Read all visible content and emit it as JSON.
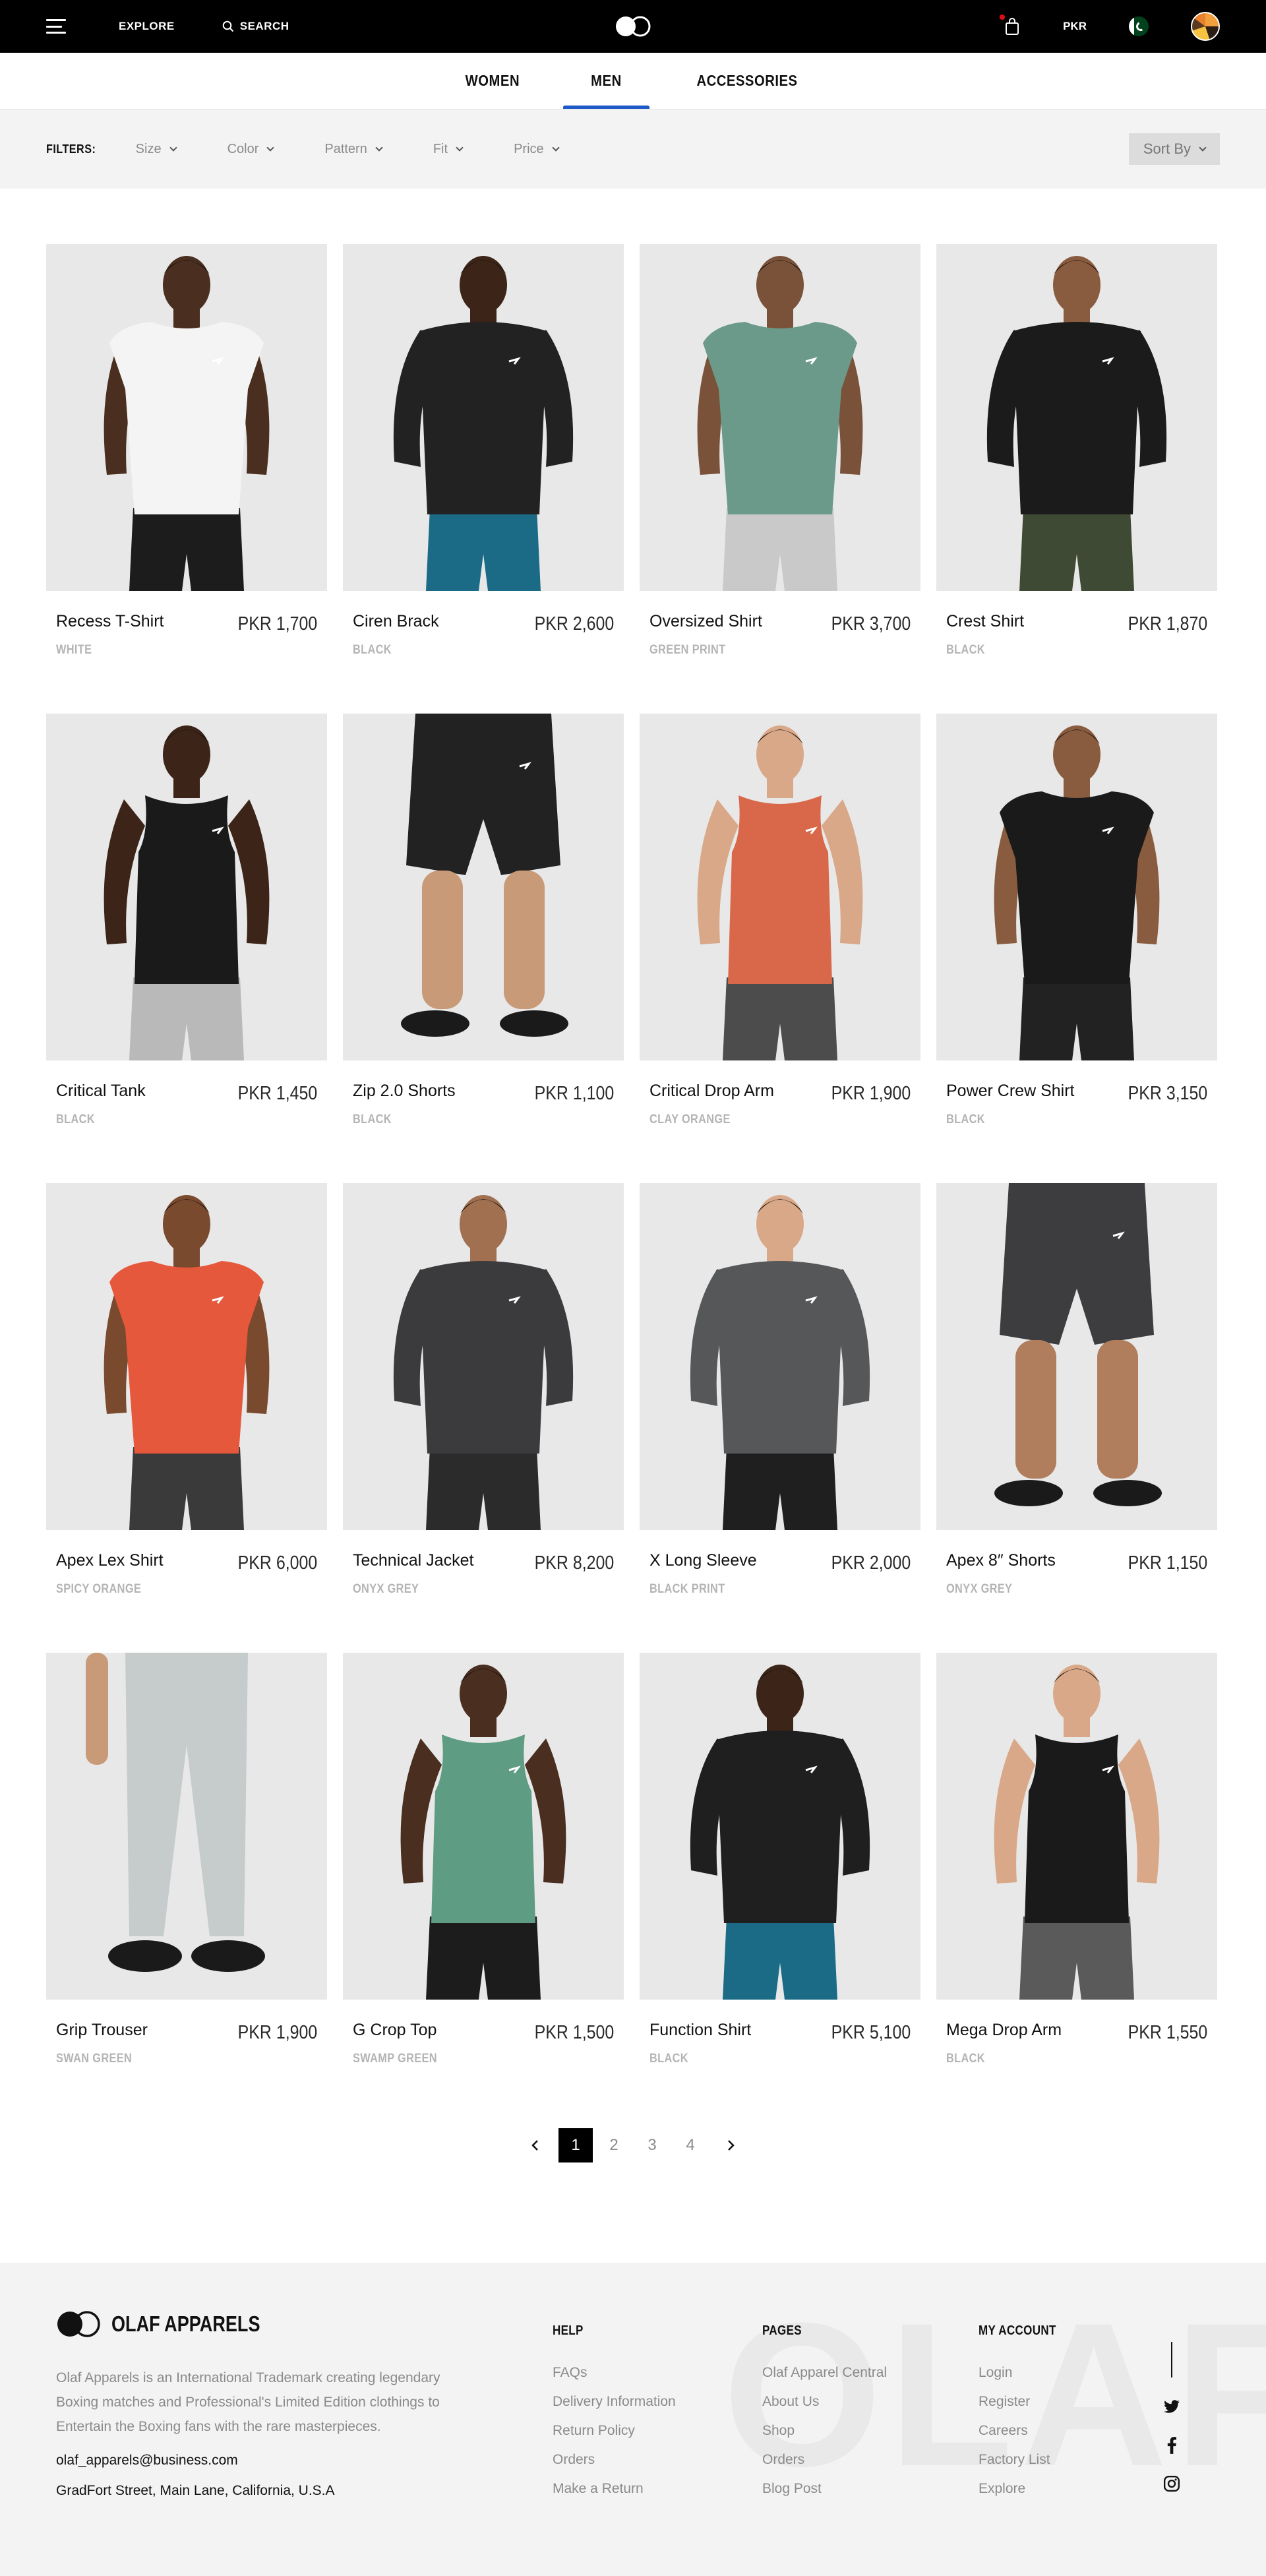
{
  "header": {
    "explore_label": "EXPLORE",
    "search_label": "SEARCH",
    "currency": "PKR"
  },
  "categories": [
    {
      "label": "WOMEN"
    },
    {
      "label": "MEN",
      "active": true
    },
    {
      "label": "ACCESSORIES"
    }
  ],
  "filters": {
    "label": "FILTERS:",
    "items": [
      {
        "label": "Size"
      },
      {
        "label": "Color"
      },
      {
        "label": "Pattern"
      },
      {
        "label": "Fit"
      },
      {
        "label": "Price"
      }
    ],
    "sort_label": "Sort By"
  },
  "products": [
    {
      "name": "Recess T-Shirt",
      "price": "PKR 1,700",
      "color": "WHITE",
      "shirt": "#f4f4f4",
      "bottom": "#1c1c1c",
      "skin": "#4a2e1f",
      "kind": "tee"
    },
    {
      "name": "Ciren Brack",
      "price": "PKR 2,600",
      "color": "BLACK",
      "shirt": "#222222",
      "bottom": "#1b6b86",
      "skin": "#3c2518",
      "kind": "long"
    },
    {
      "name": "Oversized Shirt",
      "price": "PKR 3,700",
      "color": "GREEN PRINT",
      "shirt": "#6c9a8a",
      "bottom": "#c9c9c9",
      "skin": "#7a523a",
      "kind": "tee"
    },
    {
      "name": "Crest Shirt",
      "price": "PKR 1,870",
      "color": "BLACK",
      "shirt": "#1b1b1b",
      "bottom": "#3e4a33",
      "skin": "#8a5c3f",
      "kind": "long"
    },
    {
      "name": "Critical Tank",
      "price": "PKR 1,450",
      "color": "BLACK",
      "shirt": "#1a1a1a",
      "bottom": "#b9b9b9",
      "skin": "#3c2518",
      "kind": "tank"
    },
    {
      "name": "Zip 2.0 Shorts",
      "price": "PKR 1,100",
      "color": "BLACK",
      "shirt": "#222222",
      "bottom": "#222222",
      "skin": "#c89a78",
      "kind": "shorts"
    },
    {
      "name": "Critical Drop Arm",
      "price": "PKR 1,900",
      "color": "CLAY ORANGE",
      "shirt": "#d9684a",
      "bottom": "#4c4c4c",
      "skin": "#d9a888",
      "kind": "tank"
    },
    {
      "name": "Power Crew Shirt",
      "price": "PKR 3,150",
      "color": "BLACK",
      "shirt": "#1a1a1a",
      "bottom": "#222222",
      "skin": "#8a5c3f",
      "kind": "tee"
    },
    {
      "name": "Apex Lex Shirt",
      "price": "PKR 6,000",
      "color": "SPICY ORANGE",
      "shirt": "#e6583c",
      "bottom": "#3a3a3a",
      "skin": "#7a4a2f",
      "kind": "tee"
    },
    {
      "name": "Technical Jacket",
      "price": "PKR 8,200",
      "color": "ONYX GREY",
      "shirt": "#3b3b3d",
      "bottom": "#2b2b2b",
      "skin": "#a07050",
      "kind": "long"
    },
    {
      "name": "X Long Sleeve",
      "price": "PKR 2,000",
      "color": "BLACK PRINT",
      "shirt": "#555759",
      "bottom": "#1f1f1f",
      "skin": "#d9a888",
      "kind": "long"
    },
    {
      "name": "Apex 8″ Shorts",
      "price": "PKR 1,150",
      "color": "ONYX GREY",
      "shirt": "#3d3d3f",
      "bottom": "#3d3d3f",
      "skin": "#b07e5c",
      "kind": "shorts"
    },
    {
      "name": "Grip Trouser",
      "price": "PKR 1,900",
      "color": "SWAN GREEN",
      "shirt": "#c6cbcc",
      "bottom": "#c6cbcc",
      "skin": "#c89a78",
      "kind": "trouser"
    },
    {
      "name": "G Crop Top",
      "price": "PKR 1,500",
      "color": "SWAMP GREEN",
      "shirt": "#5e9c83",
      "bottom": "#1c1c1c",
      "skin": "#4a2e1f",
      "kind": "tank"
    },
    {
      "name": "Function Shirt",
      "price": "PKR 5,100",
      "color": "BLACK",
      "shirt": "#1f1f1f",
      "bottom": "#1b6b86",
      "skin": "#3c2518",
      "kind": "long"
    },
    {
      "name": "Mega Drop Arm",
      "price": "PKR 1,550",
      "color": "BLACK",
      "shirt": "#1a1a1a",
      "bottom": "#5a5a5a",
      "skin": "#d9a888",
      "kind": "tank"
    }
  ],
  "pagination": {
    "pages": [
      "1",
      "2",
      "3",
      "4"
    ],
    "current": "1"
  },
  "footer": {
    "brand": "OLAF APPARELS",
    "watermark": "OLAF",
    "about": "Olaf Apparels is an International Trademark creating legendary Boxing matches and Professional's Limited Edition clothings to Entertain the Boxing fans with the rare masterpieces.",
    "email": "olaf_apparels@business.com",
    "address": "GradFort Street, Main Lane, California, U.S.A",
    "columns": [
      {
        "title": "HELP",
        "links": [
          "FAQs",
          "Delivery Information",
          "Return Policy",
          "Orders",
          "Make a Return"
        ]
      },
      {
        "title": "PAGES",
        "links": [
          "Olaf Apparel Central",
          "About Us",
          "Shop",
          "Orders",
          "Blog Post"
        ]
      },
      {
        "title": "MY ACCOUNT",
        "links": [
          "Login",
          "Register",
          "Careers",
          "Factory List",
          "Explore"
        ]
      }
    ],
    "social": [
      "twitter-icon",
      "facebook-icon",
      "instagram-icon"
    ]
  }
}
